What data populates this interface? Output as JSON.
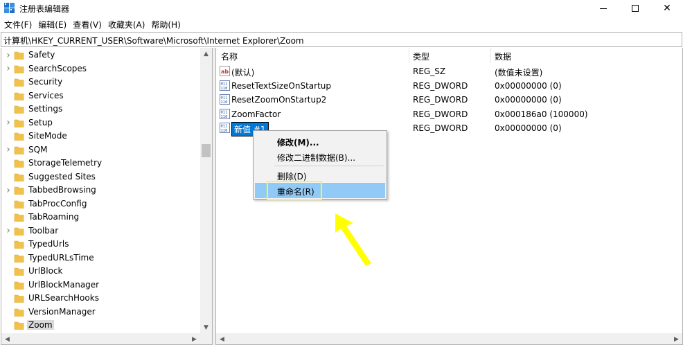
{
  "window": {
    "title": "注册表编辑器",
    "controls": {
      "minimize": "",
      "maximize": "",
      "close": "✕"
    }
  },
  "menu": [
    "文件(F)",
    "编辑(E)",
    "查看(V)",
    "收藏夹(A)",
    "帮助(H)"
  ],
  "address": "计算机\\HKEY_CURRENT_USER\\Software\\Microsoft\\Internet Explorer\\Zoom",
  "tree": [
    {
      "label": "Safety",
      "expandable": true
    },
    {
      "label": "SearchScopes",
      "expandable": true
    },
    {
      "label": "Security",
      "expandable": false
    },
    {
      "label": "Services",
      "expandable": false
    },
    {
      "label": "Settings",
      "expandable": false
    },
    {
      "label": "Setup",
      "expandable": true
    },
    {
      "label": "SiteMode",
      "expandable": false
    },
    {
      "label": "SQM",
      "expandable": true
    },
    {
      "label": "StorageTelemetry",
      "expandable": false
    },
    {
      "label": "Suggested Sites",
      "expandable": false
    },
    {
      "label": "TabbedBrowsing",
      "expandable": true
    },
    {
      "label": "TabProcConfig",
      "expandable": false
    },
    {
      "label": "TabRoaming",
      "expandable": false
    },
    {
      "label": "Toolbar",
      "expandable": true
    },
    {
      "label": "TypedUrls",
      "expandable": false
    },
    {
      "label": "TypedURLsTime",
      "expandable": false
    },
    {
      "label": "UrlBlock",
      "expandable": false
    },
    {
      "label": "UrlBlockManager",
      "expandable": false
    },
    {
      "label": "URLSearchHooks",
      "expandable": false
    },
    {
      "label": "VersionManager",
      "expandable": false
    },
    {
      "label": "Zoom",
      "expandable": false,
      "selected": true
    }
  ],
  "columns": {
    "name": "名称",
    "type": "类型",
    "data": "数据"
  },
  "values": [
    {
      "icon": "string",
      "name": "(默认)",
      "type": "REG_SZ",
      "data": "(数值未设置)"
    },
    {
      "icon": "binary",
      "name": "ResetTextSizeOnStartup",
      "type": "REG_DWORD",
      "data": "0x00000000 (0)"
    },
    {
      "icon": "binary",
      "name": "ResetZoomOnStartup2",
      "type": "REG_DWORD",
      "data": "0x00000000 (0)"
    },
    {
      "icon": "binary",
      "name": "ZoomFactor",
      "type": "REG_DWORD",
      "data": "0x000186a0 (100000)"
    },
    {
      "icon": "binary",
      "name": "新值 #1",
      "type": "REG_DWORD",
      "data": "0x00000000 (0)",
      "editing": true
    }
  ],
  "context_menu": {
    "modify": "修改(M)...",
    "modify_binary": "修改二进制数据(B)...",
    "delete": "删除(D)",
    "rename": "重命名(R)"
  },
  "colors": {
    "selection": "#0078d7",
    "menu_hover": "#91c9f7",
    "highlight_box": "#ffff00",
    "annotation_arrow": "#ffff00",
    "folder": "#f0c24b"
  }
}
